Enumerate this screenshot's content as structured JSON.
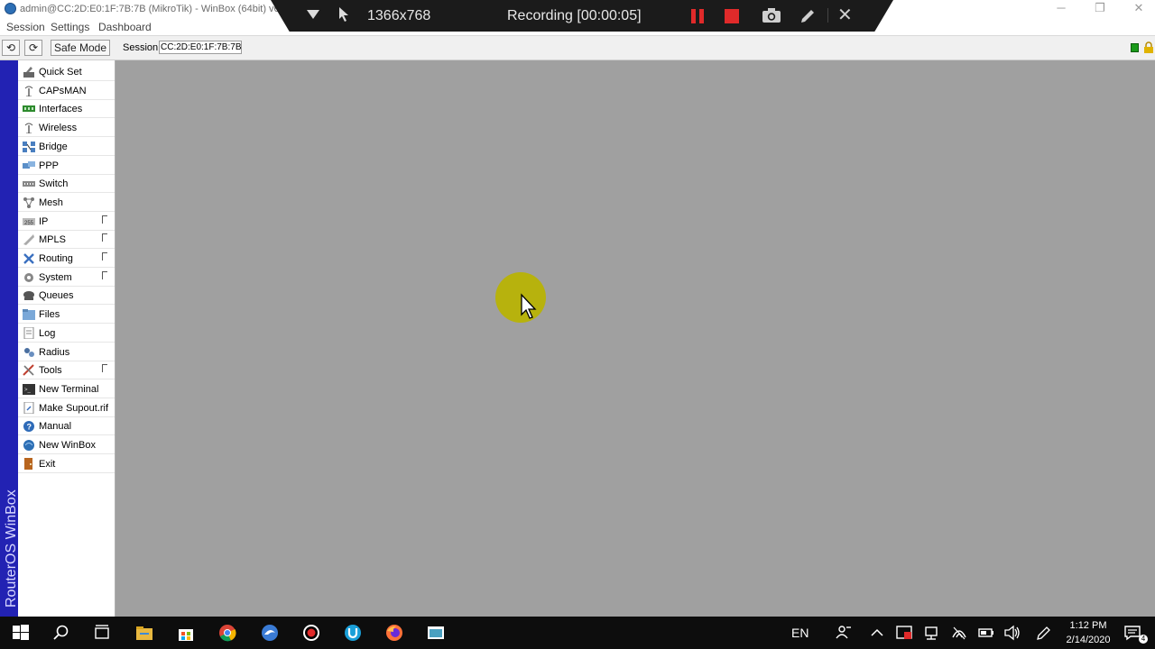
{
  "window": {
    "title": "admin@CC:2D:E0:1F:7B:7B (MikroTik) - WinBox (64bit) v6",
    "controls": {
      "minimize": "─",
      "restore": "❐",
      "close": "✕"
    }
  },
  "recorder": {
    "resolution": "1366x768",
    "status": "Recording [00:00:05]",
    "close": "✕",
    "colors": {
      "bar": "#1b1b1b",
      "record": "#e02a2a"
    }
  },
  "menubar": {
    "items": [
      "Session",
      "Settings",
      "Dashboard"
    ]
  },
  "toolbar": {
    "undo": "⟲",
    "redo": "⟳",
    "safe_mode": "Safe Mode",
    "session_label": "Session:",
    "session_value": "CC:2D:E0:1F:7B:7B"
  },
  "brand": {
    "text": "RouterOS WinBox",
    "color": "#2222b3"
  },
  "sidebar": {
    "items": [
      {
        "label": "Quick Set",
        "icon": "quick-set-icon",
        "submenu": false
      },
      {
        "label": "CAPsMAN",
        "icon": "capsman-icon",
        "submenu": false
      },
      {
        "label": "Interfaces",
        "icon": "interfaces-icon",
        "submenu": false
      },
      {
        "label": "Wireless",
        "icon": "wireless-icon",
        "submenu": false
      },
      {
        "label": "Bridge",
        "icon": "bridge-icon",
        "submenu": false
      },
      {
        "label": "PPP",
        "icon": "ppp-icon",
        "submenu": false
      },
      {
        "label": "Switch",
        "icon": "switch-icon",
        "submenu": false
      },
      {
        "label": "Mesh",
        "icon": "mesh-icon",
        "submenu": false
      },
      {
        "label": "IP",
        "icon": "ip-icon",
        "submenu": true
      },
      {
        "label": "MPLS",
        "icon": "mpls-icon",
        "submenu": true
      },
      {
        "label": "Routing",
        "icon": "routing-icon",
        "submenu": true
      },
      {
        "label": "System",
        "icon": "system-icon",
        "submenu": true
      },
      {
        "label": "Queues",
        "icon": "queues-icon",
        "submenu": false
      },
      {
        "label": "Files",
        "icon": "files-icon",
        "submenu": false
      },
      {
        "label": "Log",
        "icon": "log-icon",
        "submenu": false
      },
      {
        "label": "Radius",
        "icon": "radius-icon",
        "submenu": false
      },
      {
        "label": "Tools",
        "icon": "tools-icon",
        "submenu": true
      },
      {
        "label": "New Terminal",
        "icon": "terminal-icon",
        "submenu": false
      },
      {
        "label": "Make Supout.rif",
        "icon": "supout-icon",
        "submenu": false
      },
      {
        "label": "Manual",
        "icon": "manual-icon",
        "submenu": false
      },
      {
        "label": "New WinBox",
        "icon": "winbox-icon",
        "submenu": false
      },
      {
        "label": "Exit",
        "icon": "exit-icon",
        "submenu": false
      }
    ]
  },
  "taskbar": {
    "apps": [
      "windows-start-icon",
      "search-icon",
      "task-view-icon",
      "file-explorer-icon",
      "store-icon",
      "chrome-icon",
      "edge-icon",
      "recorder-icon",
      "uget-icon",
      "firefox-icon",
      "winbox-taskbar-icon"
    ],
    "language": "EN",
    "time": "1:12 PM",
    "date": "2/14/2020",
    "notifications": "4"
  }
}
